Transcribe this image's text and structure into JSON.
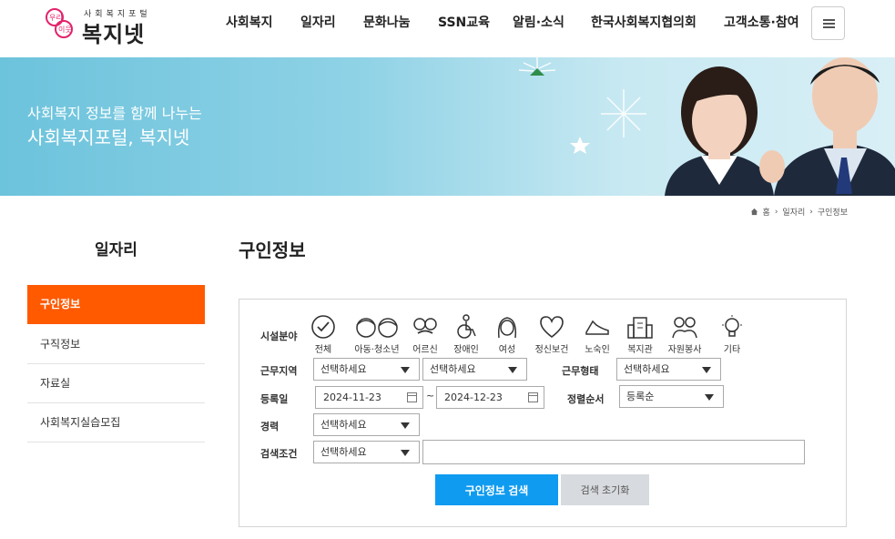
{
  "header": {
    "logo": {
      "small": "사회복지포털",
      "big": "복지넷",
      "mark_text": "우리 이웃"
    },
    "nav": [
      "사회복지",
      "일자리",
      "문화나눔",
      "SSN교육",
      "알림·소식",
      "한국사회복지협의회",
      "고객소통·참여"
    ]
  },
  "banner": {
    "line1": "사회복지 정보를 함께 나누는",
    "line2": "사회복지포털, 복지넷"
  },
  "breadcrumb": {
    "home": "홈",
    "level1": "일자리",
    "level2": "구인정보"
  },
  "sidebar": {
    "title": "일자리",
    "items": [
      "구인정보",
      "구직정보",
      "자료실",
      "사회복지실습모집"
    ]
  },
  "main": {
    "title": "구인정보",
    "form": {
      "field_label": "시설분야",
      "categories": [
        "전체",
        "아동·청소년",
        "어르신",
        "장애인",
        "여성",
        "정신보건",
        "노숙인",
        "복지관",
        "자원봉사",
        "기타"
      ],
      "region_label": "근무지역",
      "region1": "선택하세요",
      "region2": "선택하세요",
      "worktype_label": "근무형태",
      "worktype": "선택하세요",
      "date_label": "등록일",
      "date_from": "2024-11-23",
      "date_sep": "~",
      "date_to": "2024-12-23",
      "sort_label": "정렬순서",
      "sort": "등록순",
      "career_label": "경력",
      "career": "선택하세요",
      "condition_label": "검색조건",
      "condition": "선택하세요",
      "keyword": "",
      "search_button": "구인정보 검색",
      "reset_button": "검색 초기화"
    }
  },
  "colors": {
    "accent_orange": "#ff5a00",
    "search_blue": "#0f9bf0",
    "logo_pink": "#e2236b"
  }
}
